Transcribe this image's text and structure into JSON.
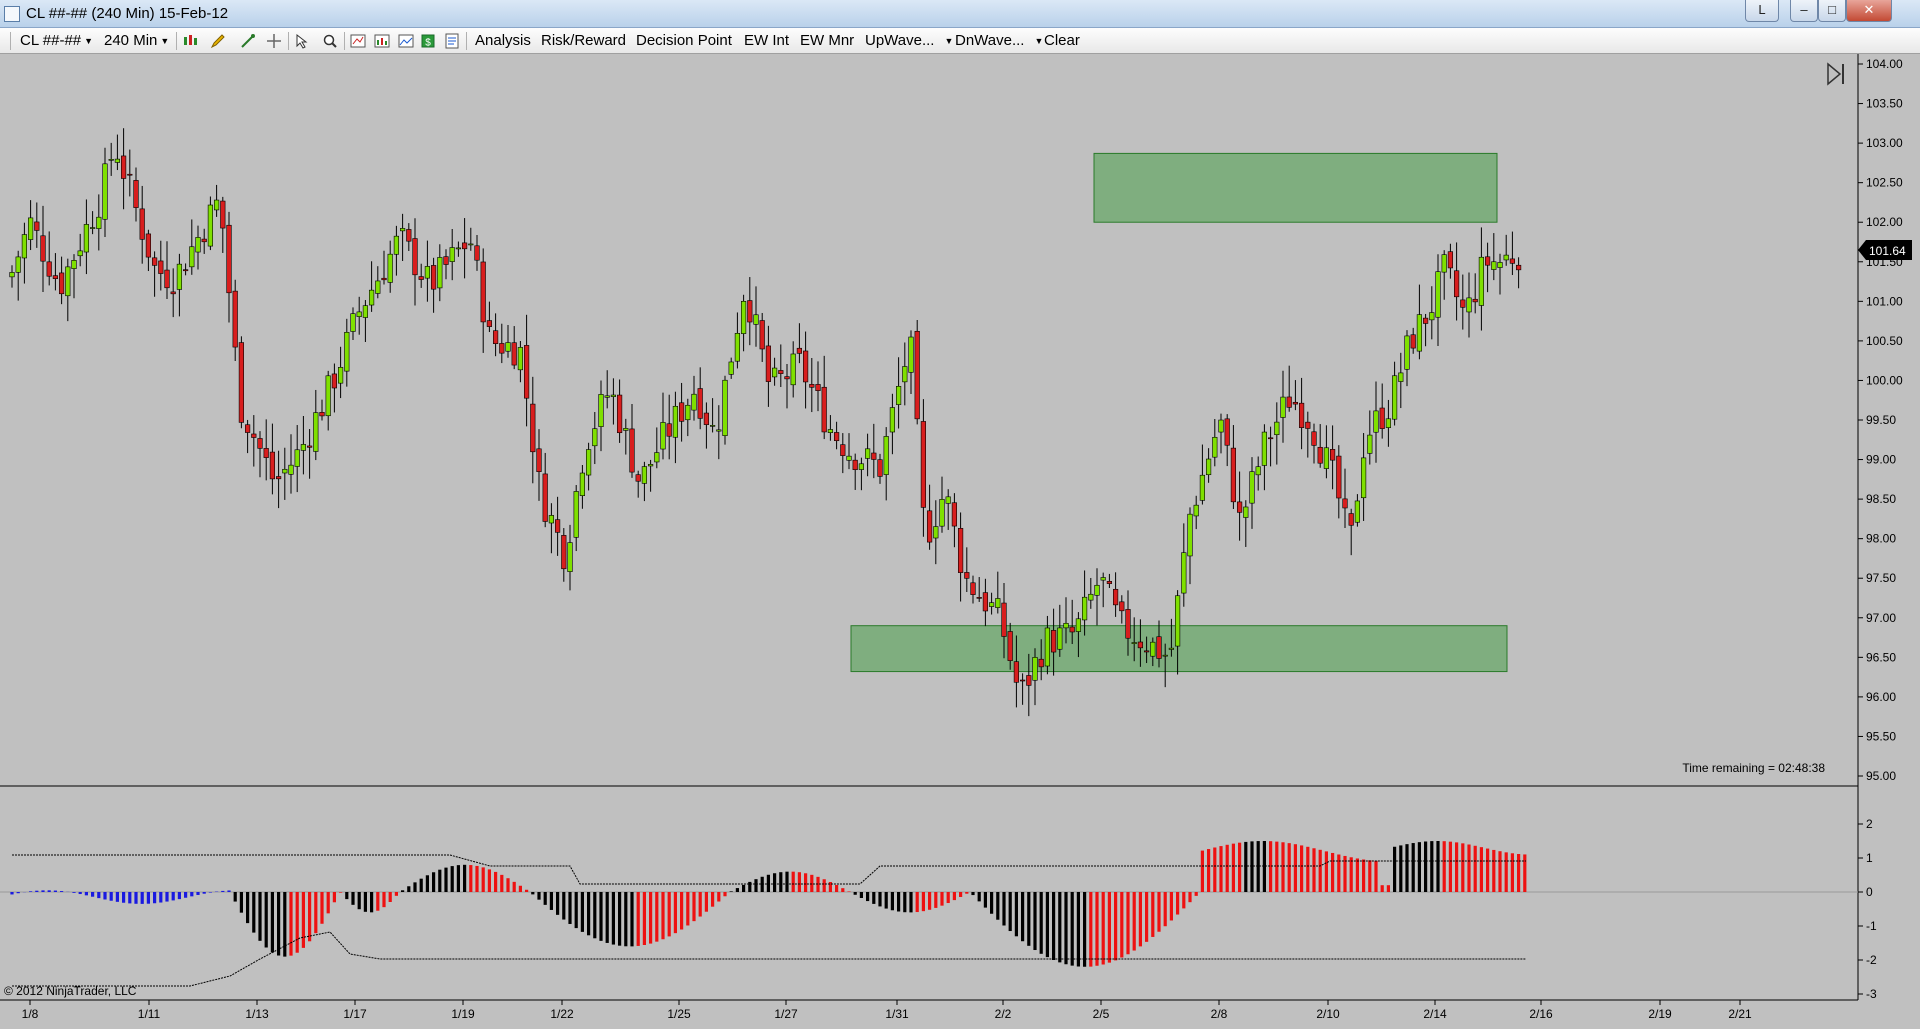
{
  "window": {
    "title": "CL ##-## (240 Min)  15-Feb-12",
    "buttons": {
      "layout": "L",
      "minimize": "–",
      "maximize": "□",
      "close": "✕"
    }
  },
  "toolbar": {
    "instrument": "CL ##-##",
    "interval": "240 Min",
    "menus": [
      "Analysis",
      "Risk/Reward",
      "Decision Point",
      "EW Int",
      "EW Mnr",
      "UpWave...",
      "DnWave...",
      "Clear"
    ]
  },
  "chart": {
    "last_price": "101.64",
    "time_remaining": "Time remaining = 02:48:38",
    "copyright": "© 2012 NinjaTrader, LLC",
    "y_ticks": [
      "104.00",
      "103.50",
      "103.00",
      "102.50",
      "102.00",
      "101.50",
      "101.00",
      "100.50",
      "100.00",
      "99.50",
      "99.00",
      "98.50",
      "98.00",
      "97.50",
      "97.00",
      "96.50",
      "96.00",
      "95.50",
      "95.00"
    ],
    "x_ticks": [
      "1/8",
      "1/11",
      "1/13",
      "1/17",
      "1/19",
      "1/22",
      "1/25",
      "1/27",
      "1/31",
      "2/2",
      "2/5",
      "2/8",
      "2/10",
      "2/14",
      "2/16",
      "2/19",
      "2/21"
    ],
    "osc_ticks": [
      "2",
      "1",
      "0",
      "-1",
      "-2",
      "-3"
    ],
    "colors": {
      "background": "#c0c0c0",
      "up": "#7fe000",
      "down": "#d81e1e",
      "zone": "#6aa86a",
      "osc_blue": "#1a1ae0",
      "osc_red": "#ee1111",
      "osc_black": "#000000"
    }
  },
  "chart_data": {
    "type": "candlestick",
    "symbol": "CL ##-##",
    "interval": "240 Min",
    "date": "15-Feb-12",
    "ylim": [
      95.0,
      104.0
    ],
    "last": 101.64,
    "zones": [
      {
        "y_low": 102.0,
        "y_high": 102.87,
        "x_start": "2/5",
        "x_end": "2/15"
      },
      {
        "y_low": 96.32,
        "y_high": 96.9,
        "x_start": "1/28",
        "x_end": "2/15"
      }
    ],
    "key_closes": [
      {
        "x": "1/8",
        "close": 101.5
      },
      {
        "x": "1/11",
        "close": 102.6
      },
      {
        "x": "1/13",
        "close": 98.7
      },
      {
        "x": "1/17",
        "close": 100.9
      },
      {
        "x": "1/19",
        "close": 101.5
      },
      {
        "x": "1/22",
        "close": 97.8
      },
      {
        "x": "1/25",
        "close": 97.9
      },
      {
        "x": "1/27",
        "close": 99.9
      },
      {
        "x": "1/31",
        "close": 98.0
      },
      {
        "x": "2/2",
        "close": 96.0
      },
      {
        "x": "2/5",
        "close": 96.8
      },
      {
        "x": "2/8",
        "close": 99.5
      },
      {
        "x": "2/10",
        "close": 98.7
      },
      {
        "x": "2/14",
        "close": 101.5
      },
      {
        "x": "2/15",
        "close": 101.64
      }
    ]
  }
}
